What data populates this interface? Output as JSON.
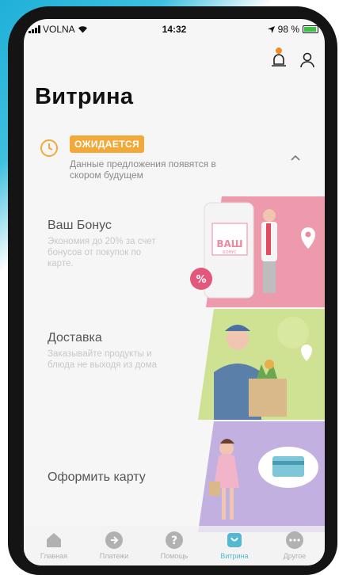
{
  "status_bar": {
    "carrier": "VOLNA",
    "time": "14:32",
    "battery": "98 %"
  },
  "page": {
    "title": "Витрина"
  },
  "status_card": {
    "badge": "ОЖИДАЕТСЯ",
    "text": "Данные предложения появятся в скором будущем"
  },
  "offers": [
    {
      "title": "Ваш Бонус",
      "desc": "Экономия до 20% за счет бонусов от покупок по карте.",
      "art_label_1": "ВАШ",
      "art_label_2": "БОНУС",
      "art_badge": "%"
    },
    {
      "title": "Доставка",
      "desc": "Заказывайте продукты и блюда не выходя из дома"
    },
    {
      "title": "Оформить карту",
      "desc": ""
    }
  ],
  "tabs": [
    {
      "label": "Главная",
      "icon": "home-icon"
    },
    {
      "label": "Платежи",
      "icon": "arrow-right-icon"
    },
    {
      "label": "Помощь",
      "icon": "question-icon"
    },
    {
      "label": "Витрина",
      "icon": "bag-icon",
      "active": true
    },
    {
      "label": "Другое",
      "icon": "more-icon"
    }
  ],
  "colors": {
    "accent": "#1ba7c7",
    "badge": "#f3a93a",
    "bonus_bg": "#ec8aa0",
    "delivery_bg": "#c6dc7a",
    "card_bg": "#b9a4dc"
  }
}
